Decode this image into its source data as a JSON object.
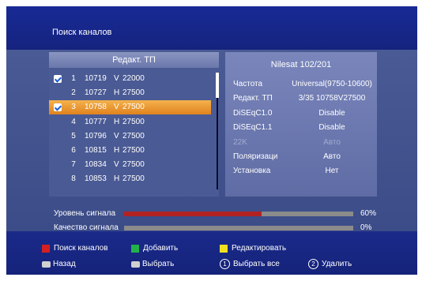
{
  "header": {
    "title": "Поиск каналов"
  },
  "transponder_list": {
    "title": "Редакт. ТП",
    "selected_index": 2,
    "rows": [
      {
        "num": "1",
        "freq": "10719",
        "pol": "V",
        "sr": "22000",
        "checked": true
      },
      {
        "num": "2",
        "freq": "10727",
        "pol": "H",
        "sr": "27500",
        "checked": false
      },
      {
        "num": "3",
        "freq": "10758",
        "pol": "V",
        "sr": "27500",
        "checked": true
      },
      {
        "num": "4",
        "freq": "10777",
        "pol": "H",
        "sr": "27500",
        "checked": false
      },
      {
        "num": "5",
        "freq": "10796",
        "pol": "V",
        "sr": "27500",
        "checked": false
      },
      {
        "num": "6",
        "freq": "10815",
        "pol": "H",
        "sr": "27500",
        "checked": false
      },
      {
        "num": "7",
        "freq": "10834",
        "pol": "V",
        "sr": "27500",
        "checked": false
      },
      {
        "num": "8",
        "freq": "10853",
        "pol": "H",
        "sr": "27500",
        "checked": false
      }
    ]
  },
  "details": {
    "satellite": "Nilesat 102/201",
    "params": [
      {
        "label": "Частота",
        "value": "Universal(9750-10600)",
        "enabled": true
      },
      {
        "label": "Редакт. ТП",
        "value": "3/35 10758V27500",
        "enabled": true
      },
      {
        "label": "DiSEqC1.0",
        "value": "Disable",
        "enabled": true
      },
      {
        "label": "DiSEqC1.1",
        "value": "Disable",
        "enabled": true
      },
      {
        "label": "22K",
        "value": "Авто",
        "enabled": false
      },
      {
        "label": "Поляризаци",
        "value": "Авто",
        "enabled": true
      },
      {
        "label": "Установка",
        "value": "Нет",
        "enabled": true
      }
    ]
  },
  "signal": {
    "level_label": "Уровень сигнала",
    "level_value": "60%",
    "level_fraction": 0.6,
    "quality_label": "Качество сигнала",
    "quality_value": "0%",
    "quality_fraction": 0.0
  },
  "footer": {
    "search": "Поиск каналов",
    "add": "Добавить",
    "edit": "Редактировать",
    "back_key": "EXIT",
    "back": "Назад",
    "ok_key": "OK",
    "select": "Выбрать",
    "select_all_key": "1",
    "select_all": "Выбрать все",
    "delete_key": "2",
    "delete": "Удалить"
  },
  "colors": {
    "red": "#d42020",
    "green": "#22b24a",
    "yellow": "#f0e020",
    "selection": "#e8931e",
    "signal_fill": "#b32222"
  }
}
